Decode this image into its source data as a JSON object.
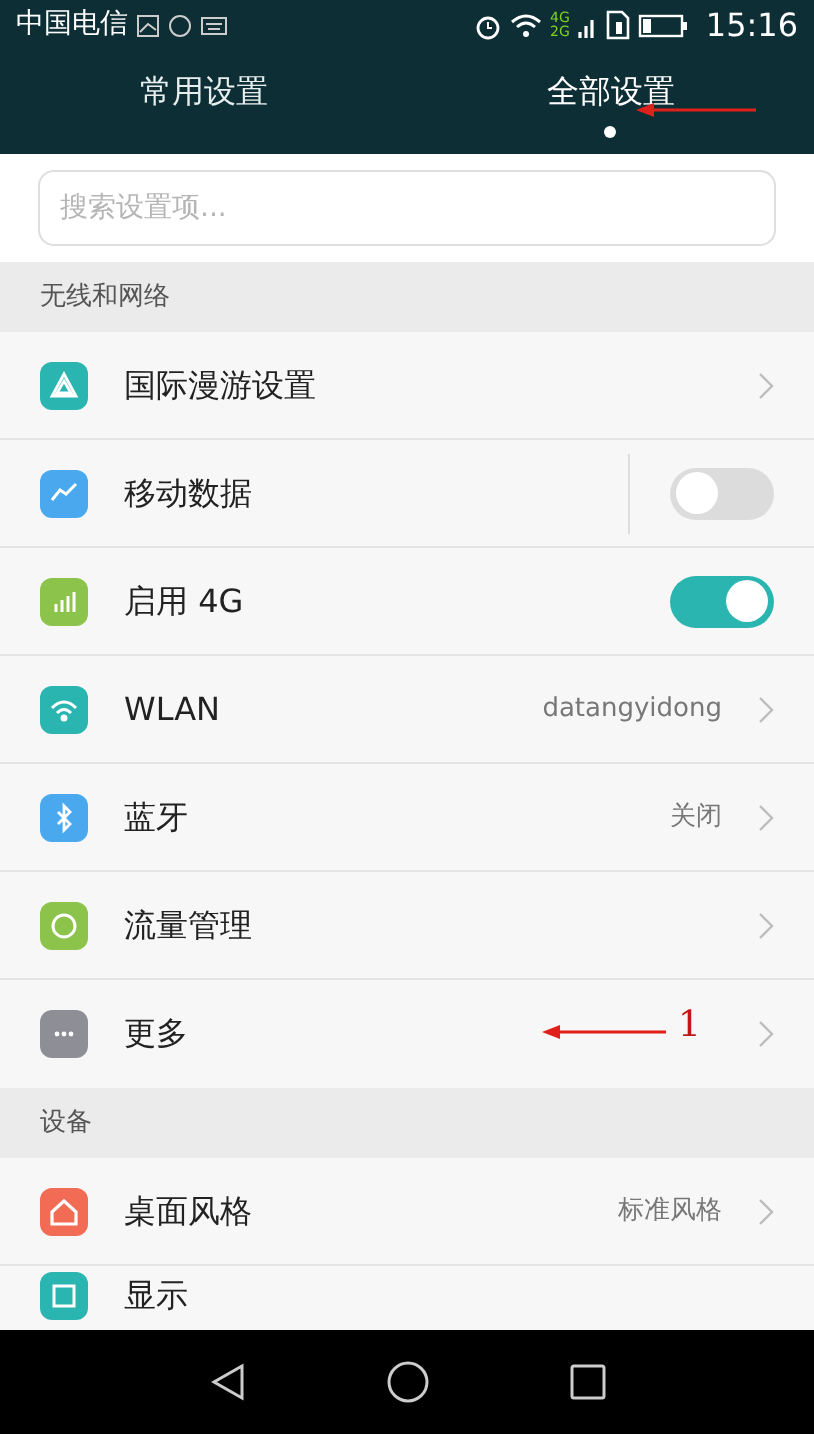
{
  "status_bar": {
    "carrier": "中国电信",
    "network_top": "4G",
    "network_bottom": "2G",
    "time": "15:16"
  },
  "tabs": [
    {
      "label": "常用设置",
      "selected": false
    },
    {
      "label": "全部设置",
      "selected": true
    }
  ],
  "search": {
    "placeholder": "搜索设置项..."
  },
  "sections": [
    {
      "title": "无线和网络",
      "rows": [
        {
          "kind": "link",
          "label": "国际漫游设置"
        },
        {
          "kind": "toggle",
          "label": "移动数据",
          "on": false
        },
        {
          "kind": "toggle",
          "label": "启用 4G",
          "on": true
        },
        {
          "kind": "link",
          "label": "WLAN",
          "value": "datangyidong"
        },
        {
          "kind": "link",
          "label": "蓝牙",
          "value": "关闭"
        },
        {
          "kind": "link",
          "label": "流量管理"
        },
        {
          "kind": "link",
          "label": "更多"
        }
      ]
    },
    {
      "title": "设备",
      "rows": [
        {
          "kind": "link",
          "label": "桌面风格",
          "value": "标准风格"
        },
        {
          "kind": "link",
          "label": "显示",
          "cut": true
        }
      ]
    }
  ],
  "annotation": {
    "label": "1"
  }
}
